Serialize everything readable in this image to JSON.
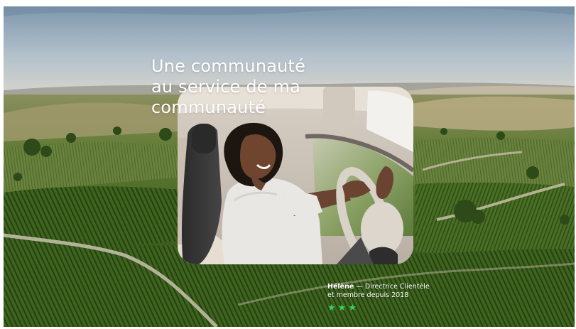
{
  "hero": {
    "headline_line1": "Une communauté",
    "headline_line2": "au service de ma",
    "headline_line3": "communauté"
  },
  "testimonial": {
    "name": "Hélène",
    "separator": " — ",
    "role": "Directrice Clientèle",
    "since": "et membre depuis 2018",
    "rating": 3,
    "star_glyph": "★",
    "star_color": "#35d35a"
  },
  "images": {
    "background": "vineyard-hills-landscape",
    "card": "woman-driving-car-smiling"
  }
}
